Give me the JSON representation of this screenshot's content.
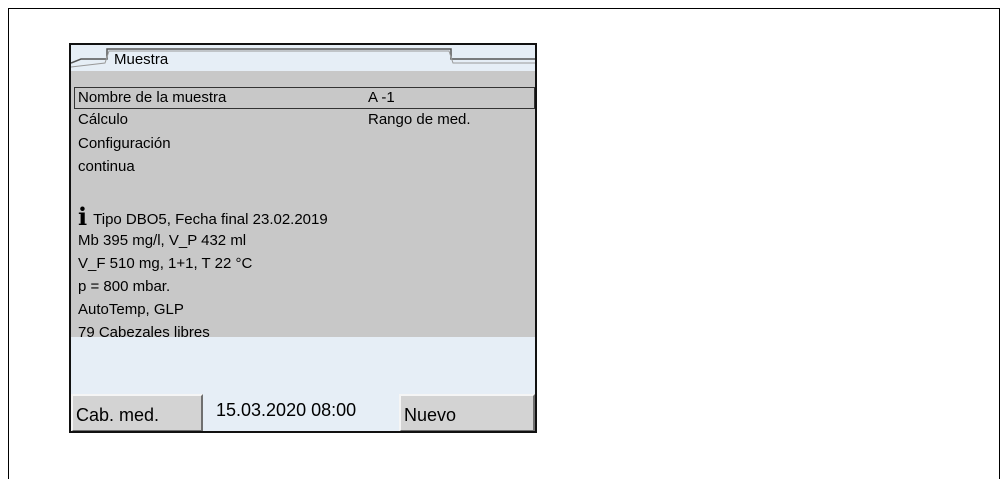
{
  "tab": {
    "label": "Muestra"
  },
  "menu": {
    "items": [
      {
        "label": "Nombre de la muestra",
        "value": "A -1"
      },
      {
        "label": "Cálculo",
        "value": "Rango de med."
      },
      {
        "label": "Configuración",
        "value": ""
      },
      {
        "label": "continua",
        "value": ""
      }
    ]
  },
  "info": {
    "icon": "info-icon",
    "lines": [
      "Tipo DBO5, Fecha final 23.02.2019",
      "Mb 395 mg/l, V_P 432 ml",
      "V_F 510 mg, 1+1, T 22 °C",
      "p = 800 mbar.",
      "AutoTemp, GLP",
      "79 Cabezales libres"
    ]
  },
  "footer": {
    "left_softkey": "Cab. med.",
    "datetime": "15.03.2020 08:00",
    "right_softkey": "Nuevo"
  }
}
